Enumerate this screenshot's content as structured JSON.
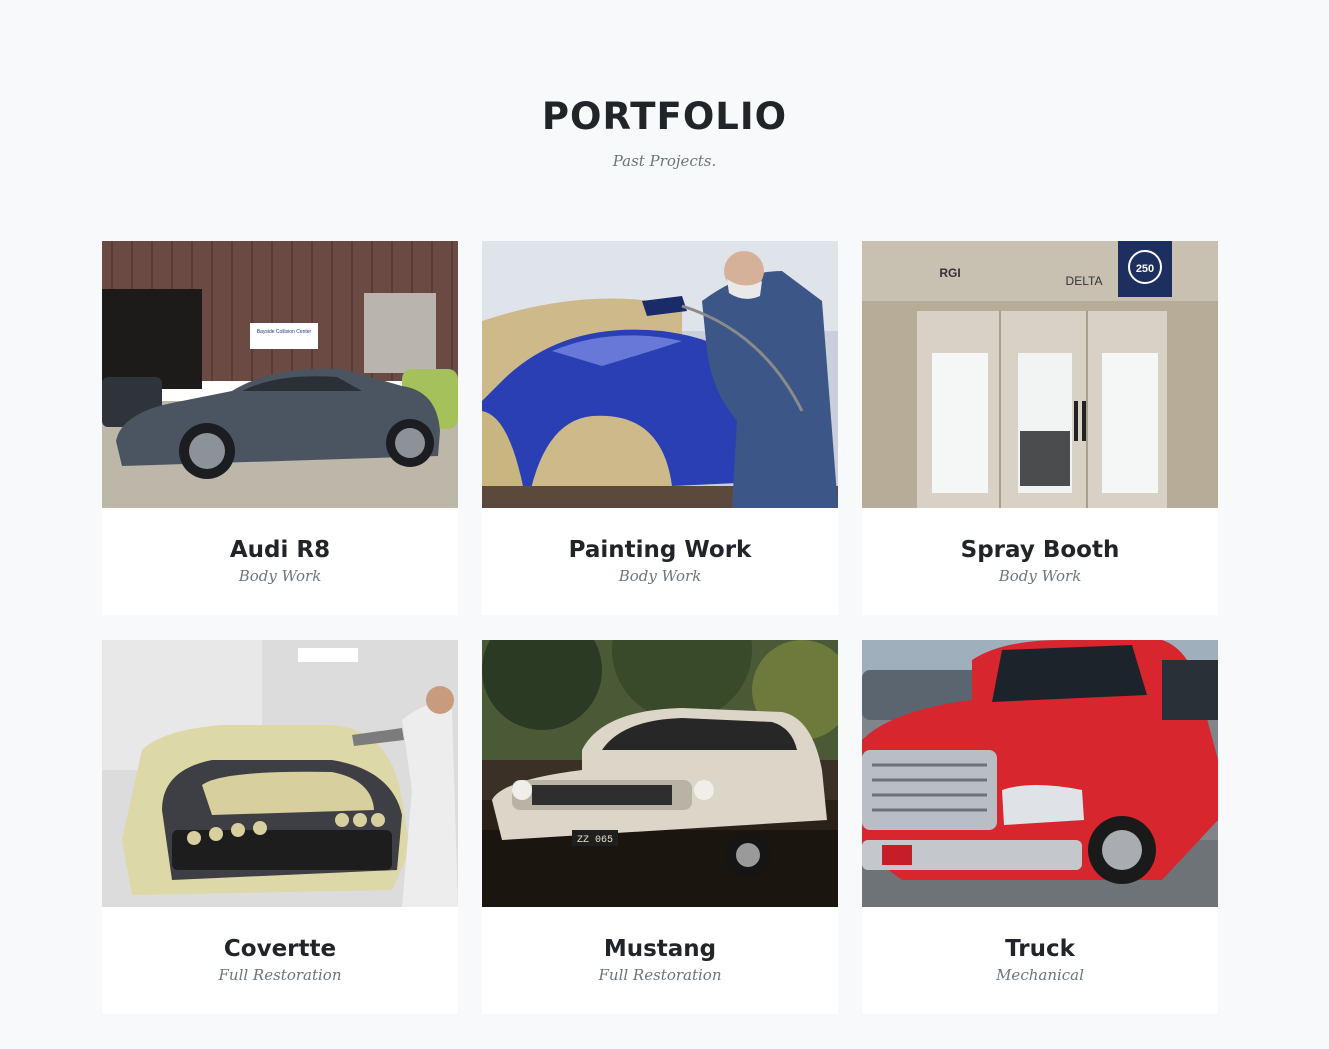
{
  "section": {
    "title": "PORTFOLIO",
    "subtitle": "Past Projects."
  },
  "items": [
    {
      "title": "Audi R8",
      "category": "Body Work",
      "sign_text": "Bayside Collision Center"
    },
    {
      "title": "Painting Work",
      "category": "Body Work"
    },
    {
      "title": "Spray Booth",
      "category": "Body Work",
      "booth_brand": "DELTA",
      "booth_model": "250",
      "booth_logo": "RGI"
    },
    {
      "title": "Covertte",
      "category": "Full Restoration"
    },
    {
      "title": "Mustang",
      "category": "Full Restoration",
      "plate": "ZZ 065"
    },
    {
      "title": "Truck",
      "category": "Mechanical"
    }
  ]
}
